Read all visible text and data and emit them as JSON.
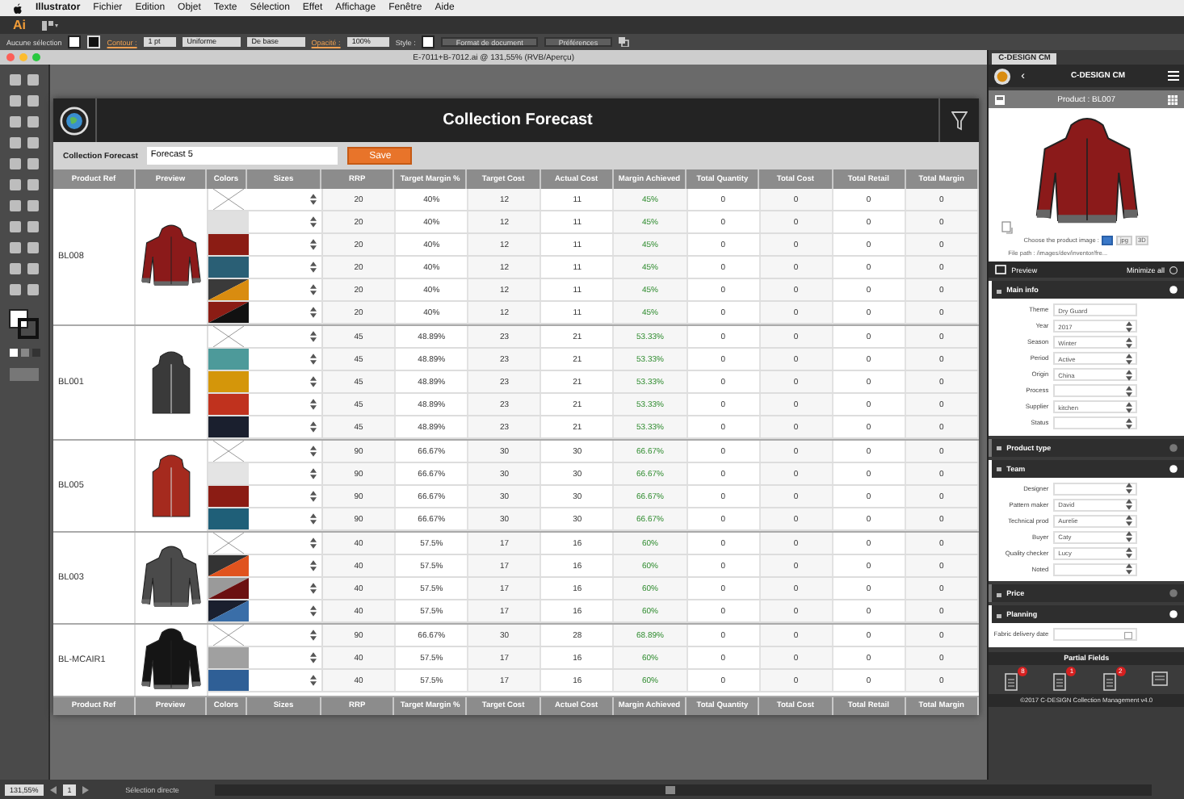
{
  "menu_bar": {
    "app": "Illustrator",
    "items": [
      "Fichier",
      "Edition",
      "Objet",
      "Texte",
      "Sélection",
      "Effet",
      "Affichage",
      "Fenêtre",
      "Aide"
    ]
  },
  "app_bar": {
    "logo": "Ai"
  },
  "control_bar": {
    "selection": "Aucune sélection",
    "stroke_label": "Contour :",
    "stroke_weight": "1 pt",
    "profile": "Uniforme",
    "brush": "De base",
    "opacity_label": "Opacité :",
    "opacity": "100%",
    "style_label": "Style :",
    "buttons": [
      "Format de document",
      "Préférences"
    ]
  },
  "document_tab": {
    "title": "E-7011+B-7012.ai @ 131,55% (RVB/Aperçu)"
  },
  "plugin": {
    "title": "Collection Forecast",
    "forecast_label": "Collection Forecast",
    "forecast_name": "Forecast 5",
    "save": "Save",
    "table": {
      "columns": [
        "Product Ref",
        "Preview",
        "Colors",
        "Sizes",
        "RRP",
        "Target Margin %",
        "Target Cost",
        "Actual Cost",
        "Margin Achieved",
        "Total Quantity",
        "Total Cost",
        "Total Retail",
        "Total Margin"
      ],
      "footer_columns": [
        "Product Ref",
        "Preview",
        "Colors",
        "Sizes",
        "RRP",
        "Target Margin %",
        "Target Cost",
        "Actuel Cost",
        "Margin Achieved",
        "Total Quantity",
        "Total Cost",
        "Total Retail",
        "Total Margin"
      ],
      "groups": [
        {
          "ref": "BL008",
          "preview": {
            "kind": "jacket",
            "color": "#8b1a1a"
          },
          "rows": [
            {
              "swatch": {
                "kind": "none"
              },
              "values": [
                "20",
                "40%",
                "12",
                "11",
                "45%",
                "0",
                "0",
                "0",
                "0"
              ]
            },
            {
              "swatch": {
                "kind": "solid",
                "color": "#e0e0e0"
              },
              "values": [
                "20",
                "40%",
                "12",
                "11",
                "45%",
                "0",
                "0",
                "0",
                "0"
              ]
            },
            {
              "swatch": {
                "kind": "solid",
                "color": "#8b1c14"
              },
              "values": [
                "20",
                "40%",
                "12",
                "11",
                "45%",
                "0",
                "0",
                "0",
                "0"
              ]
            },
            {
              "swatch": {
                "kind": "solid",
                "color": "#2a5f75"
              },
              "values": [
                "20",
                "40%",
                "12",
                "11",
                "45%",
                "0",
                "0",
                "0",
                "0"
              ]
            },
            {
              "swatch": {
                "kind": "split",
                "parts": [
                  {
                    "color": "#3a3a3a"
                  },
                  {
                    "color": "#d98c10"
                  }
                ]
              },
              "values": [
                "20",
                "40%",
                "12",
                "11",
                "45%",
                "0",
                "0",
                "0",
                "0"
              ]
            },
            {
              "swatch": {
                "kind": "split",
                "parts": [
                  {
                    "color": "#8b1c14"
                  },
                  {
                    "color": "#111111"
                  }
                ]
              },
              "values": [
                "20",
                "40%",
                "12",
                "11",
                "45%",
                "0",
                "0",
                "0",
                "0"
              ]
            }
          ]
        },
        {
          "ref": "BL001",
          "preview": {
            "kind": "vest",
            "color": "#3a3a3a"
          },
          "rows": [
            {
              "swatch": {
                "kind": "none"
              },
              "values": [
                "45",
                "48.89%",
                "23",
                "21",
                "53.33%",
                "0",
                "0",
                "0",
                "0"
              ]
            },
            {
              "swatch": {
                "kind": "solid",
                "color": "#4d9a9a"
              },
              "values": [
                "45",
                "48.89%",
                "23",
                "21",
                "53.33%",
                "0",
                "0",
                "0",
                "0"
              ]
            },
            {
              "swatch": {
                "kind": "solid",
                "color": "#d4960a"
              },
              "values": [
                "45",
                "48.89%",
                "23",
                "21",
                "53.33%",
                "0",
                "0",
                "0",
                "0"
              ]
            },
            {
              "swatch": {
                "kind": "solid",
                "color": "#c0321e"
              },
              "values": [
                "45",
                "48.89%",
                "23",
                "21",
                "53.33%",
                "0",
                "0",
                "0",
                "0"
              ]
            },
            {
              "swatch": {
                "kind": "solid",
                "color": "#1a1f2e"
              },
              "values": [
                "45",
                "48.89%",
                "23",
                "21",
                "53.33%",
                "0",
                "0",
                "0",
                "0"
              ]
            }
          ]
        },
        {
          "ref": "BL005",
          "preview": {
            "kind": "vest",
            "color": "#a52a1e"
          },
          "rows": [
            {
              "swatch": {
                "kind": "none"
              },
              "values": [
                "90",
                "66.67%",
                "30",
                "30",
                "66.67%",
                "0",
                "0",
                "0",
                "0"
              ]
            },
            {
              "swatch": {
                "kind": "solid",
                "color": "#e4e4e4"
              },
              "values": [
                "90",
                "66.67%",
                "30",
                "30",
                "66.67%",
                "0",
                "0",
                "0",
                "0"
              ]
            },
            {
              "swatch": {
                "kind": "solid",
                "color": "#8b1c14"
              },
              "values": [
                "90",
                "66.67%",
                "30",
                "30",
                "66.67%",
                "0",
                "0",
                "0",
                "0"
              ]
            },
            {
              "swatch": {
                "kind": "solid",
                "color": "#1f5f78"
              },
              "values": [
                "90",
                "66.67%",
                "30",
                "30",
                "66.67%",
                "0",
                "0",
                "0",
                "0"
              ]
            }
          ]
        },
        {
          "ref": "BL003",
          "preview": {
            "kind": "jacket",
            "color": "#4a4a4a"
          },
          "rows": [
            {
              "swatch": {
                "kind": "none"
              },
              "values": [
                "40",
                "57.5%",
                "17",
                "16",
                "60%",
                "0",
                "0",
                "0",
                "0"
              ]
            },
            {
              "swatch": {
                "kind": "split",
                "parts": [
                  {
                    "color": "#333333"
                  },
                  {
                    "color": "#e0531e"
                  }
                ]
              },
              "values": [
                "40",
                "57.5%",
                "17",
                "16",
                "60%",
                "0",
                "0",
                "0",
                "0"
              ]
            },
            {
              "swatch": {
                "kind": "split",
                "parts": [
                  {
                    "color": "#9a9a9a"
                  },
                  {
                    "color": "#6b1010"
                  }
                ]
              },
              "values": [
                "40",
                "57.5%",
                "17",
                "16",
                "60%",
                "0",
                "0",
                "0",
                "0"
              ]
            },
            {
              "swatch": {
                "kind": "split",
                "parts": [
                  {
                    "color": "#1a1f2e"
                  },
                  {
                    "color": "#3a6ea8"
                  }
                ]
              },
              "values": [
                "40",
                "57.5%",
                "17",
                "16",
                "60%",
                "0",
                "0",
                "0",
                "0"
              ]
            }
          ]
        },
        {
          "ref": "BL-MCAIR1",
          "preview": {
            "kind": "jacket",
            "color": "#151515"
          },
          "rows": [
            {
              "swatch": {
                "kind": "none"
              },
              "values": [
                "90",
                "66.67%",
                "30",
                "28",
                "68.89%",
                "0",
                "0",
                "0",
                "0"
              ]
            },
            {
              "swatch": {
                "kind": "solid",
                "color": "#a0a0a0"
              },
              "values": [
                "40",
                "57.5%",
                "17",
                "16",
                "60%",
                "0",
                "0",
                "0",
                "0"
              ]
            },
            {
              "swatch": {
                "kind": "solid",
                "color": "#2f5f96"
              },
              "values": [
                "40",
                "57.5%",
                "17",
                "16",
                "60%",
                "0",
                "0",
                "0",
                "0"
              ]
            }
          ]
        }
      ]
    }
  },
  "side_panel": {
    "tab": "C-DESIGN CM",
    "back": "‹",
    "title": "C-DESIGN CM",
    "image": {
      "kind": "jacket",
      "color": "#8b1a1a"
    },
    "product": "Product : BL007",
    "image_label": "Choose the product image :",
    "image_options": [
      {
        "kind": "icon",
        "selected": true
      },
      {
        "kind": "text",
        "label": "jpg",
        "selected": false
      },
      {
        "kind": "text",
        "label": "3D",
        "selected": false
      }
    ],
    "file_path": "File path : /images/dev/inventor/fre...",
    "preview": "Preview",
    "minimize": "Minimize all",
    "sections": [
      {
        "title": "Main info",
        "expanded": true,
        "fields": [
          {
            "label": "Theme",
            "kind": "text",
            "value": "Dry Guard"
          },
          {
            "label": "Year",
            "kind": "select",
            "value": "2017"
          },
          {
            "label": "Season",
            "kind": "select",
            "value": "Winter"
          },
          {
            "label": "Period",
            "kind": "select",
            "value": "Active"
          },
          {
            "label": "Origin",
            "kind": "select",
            "value": "China"
          },
          {
            "label": "Process",
            "kind": "select"
          },
          {
            "label": "Supplier",
            "kind": "select",
            "value": "kitchen"
          },
          {
            "label": "Status",
            "kind": "select"
          }
        ]
      },
      {
        "title": "Product type",
        "expanded": false
      },
      {
        "title": "Team",
        "expanded": true,
        "fields": [
          {
            "label": "Designer",
            "kind": "select"
          },
          {
            "label": "Pattern maker",
            "kind": "select",
            "value": "David"
          },
          {
            "label": "Technical prod",
            "kind": "select",
            "value": "Aurelie"
          },
          {
            "label": "Buyer",
            "kind": "select",
            "value": "Caty"
          },
          {
            "label": "Quality checker",
            "kind": "select",
            "value": "Lucy"
          },
          {
            "label": "Noted",
            "kind": "select"
          }
        ]
      },
      {
        "title": "Price",
        "expanded": false
      },
      {
        "title": "Planning",
        "expanded": true,
        "fields": [
          {
            "label": "Fabric delivery date",
            "kind": "date"
          }
        ]
      }
    ],
    "partial_fields": "Partial Fields",
    "badges": [
      "8",
      "1",
      "2"
    ],
    "footer": "©2017 C-DESIGN Collection Management v4.0"
  },
  "status_bar": {
    "zoom": "131,55%",
    "page": "1",
    "tool": "Sélection directe"
  }
}
